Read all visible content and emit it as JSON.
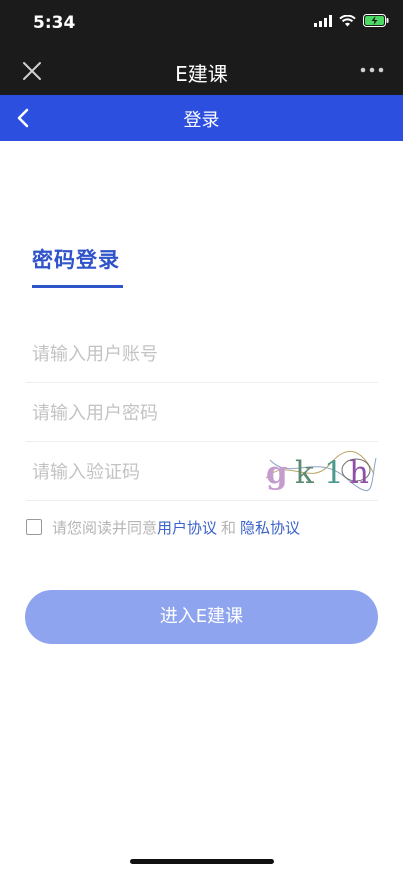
{
  "status_bar": {
    "time": "5:34"
  },
  "app_bar": {
    "title": "E建课",
    "close_icon": "close-icon",
    "more_icon": "more-dots-icon"
  },
  "page_bar": {
    "title": "登录",
    "back_icon": "chevron-left-icon"
  },
  "login": {
    "tab_label": "密码登录",
    "account_placeholder": "请输入用户账号",
    "password_placeholder": "请输入用户密码",
    "captcha_placeholder": "请输入验证码",
    "captcha_text": "gk1h"
  },
  "agreement": {
    "prefix": "请您阅读并同意",
    "user_agreement": "用户协议",
    "conjunction": "和",
    "privacy_policy": "隐私协议"
  },
  "submit_label": "进入E建课",
  "colors": {
    "nav_dark": "#1b1b1b",
    "nav_blue": "#2d4fe0",
    "accent": "#2f54c9",
    "button_disabled": "#8fa4ee"
  }
}
